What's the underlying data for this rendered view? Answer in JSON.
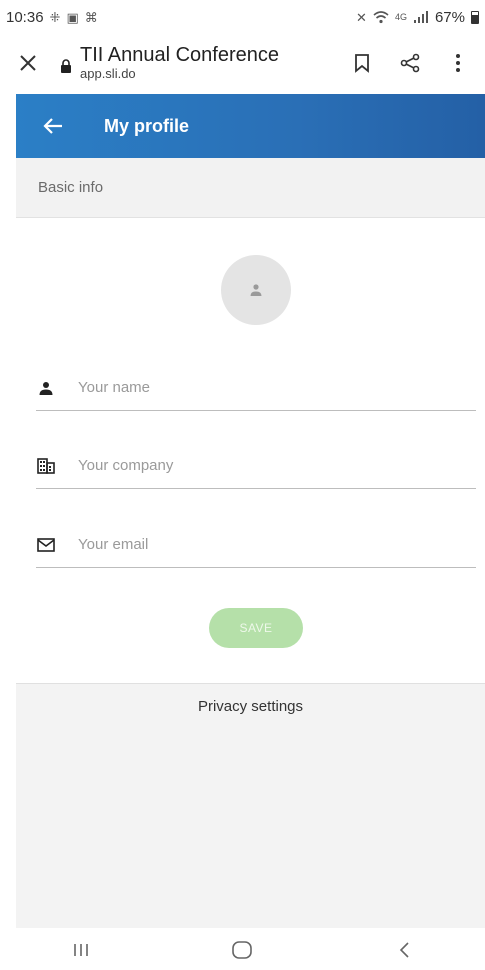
{
  "status_bar": {
    "time": "10:36",
    "battery": "67%",
    "network": "4G"
  },
  "browser": {
    "title": "TII Annual Conference",
    "domain": "app.sli.do"
  },
  "app_header": {
    "title": "My profile"
  },
  "section": {
    "title": "Basic info"
  },
  "form": {
    "name_placeholder": "Your name",
    "company_placeholder": "Your company",
    "email_placeholder": "Your email",
    "save_label": "SAVE"
  },
  "privacy": {
    "title": "Privacy settings"
  },
  "colors": {
    "header_blue": "#2b7fc6",
    "save_green": "#b5e0a9",
    "section_gray": "#f2f2f2"
  }
}
